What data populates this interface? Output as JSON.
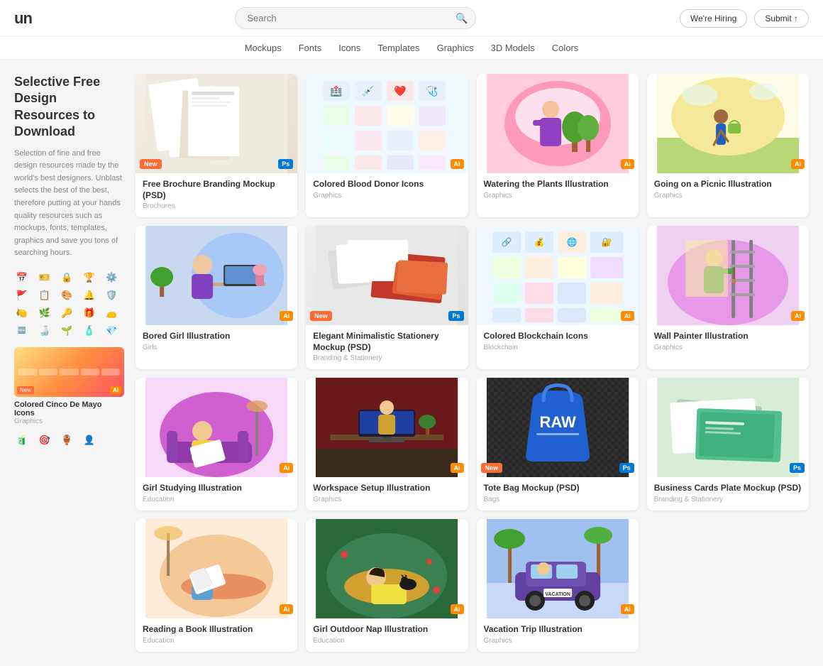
{
  "header": {
    "logo": "un",
    "search_placeholder": "Search",
    "nav_items": [
      "Mockups",
      "Fonts",
      "Icons",
      "Templates",
      "Graphics",
      "3D Models",
      "Colors"
    ],
    "hiring_label": "We're Hiring",
    "submit_label": "Submit ↑"
  },
  "sidebar": {
    "heading": "Selective Free Design Resources to Download",
    "description": "Selection of fine and free design resources made by the world's best designers. Unblast selects the best of the best, therefore putting at your hands quality resources such as mockups, fonts, templates, graphics and save you tons of searching hours.",
    "bottom_item": {
      "tag": "New",
      "type": "Ai",
      "title": "Colored Cinco De Mayo Icons",
      "category": "Graphics"
    }
  },
  "cards": [
    {
      "id": "free-brochure",
      "title": "Free Brochure Branding Mockup (PSD)",
      "category": "Brochures",
      "badge": "New",
      "type": "Ps",
      "thumb_type": "brochure"
    },
    {
      "id": "blood-donor",
      "title": "Colored Blood Donor Icons",
      "category": "Graphics",
      "badge": null,
      "type": "Ai",
      "thumb_type": "icons"
    },
    {
      "id": "watering-plants",
      "title": "Watering the Plants Illustration",
      "category": "Graphics",
      "badge": null,
      "type": "Ai",
      "thumb_type": "watering"
    },
    {
      "id": "going-picnic",
      "title": "Going on a Picnic Illustration",
      "category": "Graphics",
      "badge": null,
      "type": "Ai",
      "thumb_type": "picnic"
    },
    {
      "id": "bored-girl",
      "title": "Bored Girl Illustration",
      "category": "Girls",
      "badge": null,
      "type": "Ai",
      "thumb_type": "bored"
    },
    {
      "id": "elegant-stationery",
      "title": "Elegant Minimalistic Stationery Mockup (PSD)",
      "category": "Branding & Stationery",
      "badge": "New",
      "type": "Ps",
      "thumb_type": "stationery"
    },
    {
      "id": "blockchain-icons",
      "title": "Colored Blockchain Icons",
      "category": "Blockchain",
      "badge": null,
      "type": "Ai",
      "thumb_type": "blockchain"
    },
    {
      "id": "wall-painter",
      "title": "Wall Painter Illustration",
      "category": "Graphics",
      "badge": null,
      "type": "Ai",
      "thumb_type": "painter"
    },
    {
      "id": "girl-studying",
      "title": "Girl Studying Illustration",
      "category": "Education",
      "badge": null,
      "type": "Ai",
      "thumb_type": "studying"
    },
    {
      "id": "workspace-setup",
      "title": "Workspace Setup Illustration",
      "category": "Graphics",
      "badge": null,
      "type": "Ai",
      "thumb_type": "workspace"
    },
    {
      "id": "tote-bag",
      "title": "Tote Bag Mockup (PSD)",
      "category": "Bags",
      "badge": "New",
      "type": "Ps",
      "thumb_type": "tote"
    },
    {
      "id": "business-cards",
      "title": "Business Cards Plate Mockup (PSD)",
      "category": "Branding & Stationery",
      "badge": null,
      "type": "Ps",
      "thumb_type": "bizcard"
    },
    {
      "id": "reading-book",
      "title": "Reading a Book Illustration",
      "category": "Education",
      "badge": null,
      "type": "Ai",
      "thumb_type": "reading"
    },
    {
      "id": "girl-outdoor",
      "title": "Girl Outdoor Nap Illustration",
      "category": "Education",
      "badge": null,
      "type": "Ai",
      "thumb_type": "outdoor"
    },
    {
      "id": "vacation-trip",
      "title": "Vacation Trip Illustration",
      "category": "Graphics",
      "badge": null,
      "type": "Ai",
      "thumb_type": "vacation"
    }
  ]
}
